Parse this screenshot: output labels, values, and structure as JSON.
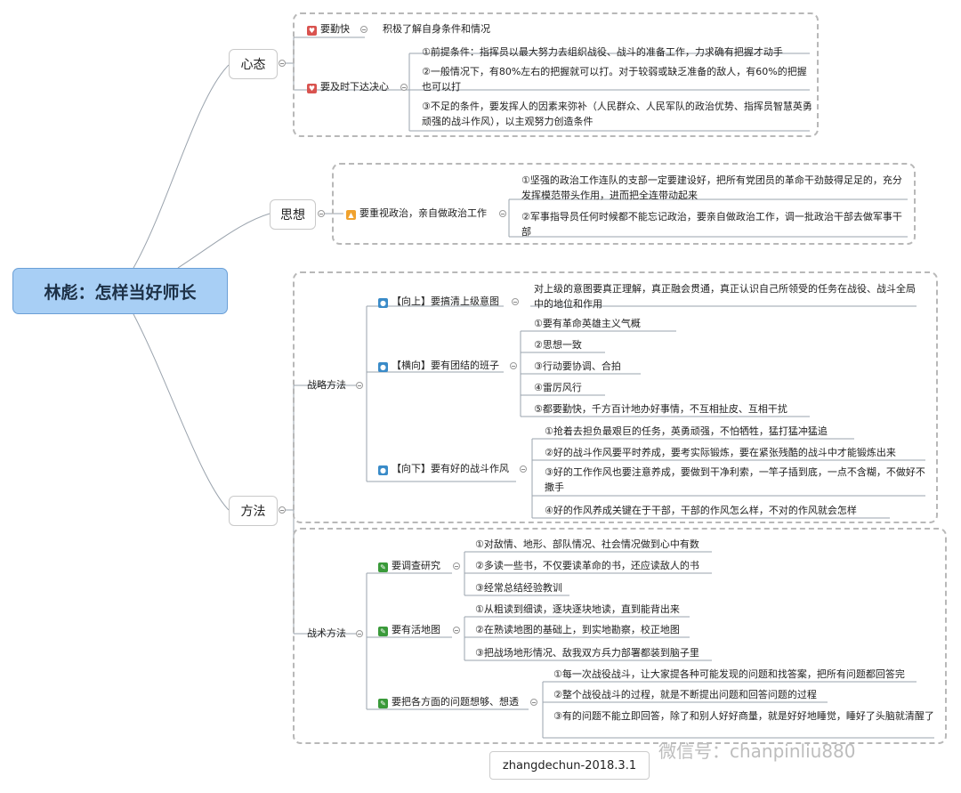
{
  "root": "林彪：怎样当好师长",
  "mind": {
    "label": "心态",
    "a": "要勤快",
    "a_note": "积极了解自身条件和情况",
    "b": "要及时下达决心",
    "b_items": [
      "①前提条件：指挥员以最大努力去组织战役、战斗的准备工作，力求确有把握才动手",
      "②一般情况下，有80%左右的把握就可以打。对于较弱或缺乏准备的敌人，有60%的把握也可以打",
      "③不足的条件，要发挥人的因素来弥补（人民群众、人民军队的政治优势、指挥员智慧英勇顽强的战斗作风），以主观努力创造条件"
    ]
  },
  "thought": {
    "label": "思想",
    "a": "要重视政治，亲自做政治工作",
    "a_items": [
      "①坚强的政治工作连队的支部一定要建设好，把所有党团员的革命干劲鼓得足足的，充分发挥模范带头作用，进而把全连带动起来",
      "②军事指导员任何时候都不能忘记政治，要亲自做政治工作，调一批政治干部去做军事干部"
    ]
  },
  "method": {
    "label": "方法",
    "strategy": {
      "label": "战略方法",
      "up": "【向上】要搞清上级意图",
      "up_note": "对上级的意图要真正理解，真正融会贯通，真正认识自己所领受的任务在战役、战斗全局中的地位和作用",
      "across": "【横向】要有团结的班子",
      "across_items": [
        "①要有革命英雄主义气概",
        "②思想一致",
        "③行动要协调、合拍",
        "④雷厉风行",
        "⑤都要勤快，千方百计地办好事情，不互相扯皮、互相干扰"
      ],
      "down": "【向下】要有好的战斗作风",
      "down_items": [
        "①抢着去担负最艰巨的任务，英勇顽强，不怕牺牲，猛打猛冲猛追",
        "②好的战斗作风要平时养成，要考实际锻炼，要在紧张残酷的战斗中才能锻炼出来",
        "③好的工作作风也要注意养成，要做到干净利索，一竿子插到底，一点不含糊，不做好不撒手",
        "④好的作风养成关键在于干部，干部的作风怎么样，不对的作风就会怎样"
      ]
    },
    "tactics": {
      "label": "战术方法",
      "a": "要调查研究",
      "a_items": [
        "①对敌情、地形、部队情况、社会情况做到心中有数",
        "②多读一些书，不仅要读革命的书，还应读敌人的书",
        "③经常总结经验教训"
      ],
      "b": "要有活地图",
      "b_items": [
        "①从粗读到细读，逐块逐块地读，直到能背出来",
        "②在熟读地图的基础上，到实地勘察，校正地图",
        "③把战场地形情况、敌我双方兵力部署都装到脑子里"
      ],
      "c": "要把各方面的问题想够、想透",
      "c_items": [
        "①每一次战役战斗，让大家提各种可能发现的问题和找答案，把所有问题都回答完",
        "②整个战役战斗的过程，就是不断提出问题和回答问题的过程",
        "③有的问题不能立即回答，除了和别人好好商量，就是好好地睡觉，睡好了头脑就清醒了"
      ]
    }
  },
  "signature": "zhangdechun-2018.3.1",
  "watermark": "微信号：chanpinliu880",
  "colors": {
    "root_fill": "#a8cff5",
    "heart": "#d9534f",
    "thumb": "#f0a22e",
    "person": "#3a8bc8",
    "pen": "#3a9a3a"
  },
  "icons": {
    "heart": "heart-icon",
    "thumb": "thumbs-up-icon",
    "person": "person-icon",
    "pen": "pencil-icon"
  }
}
